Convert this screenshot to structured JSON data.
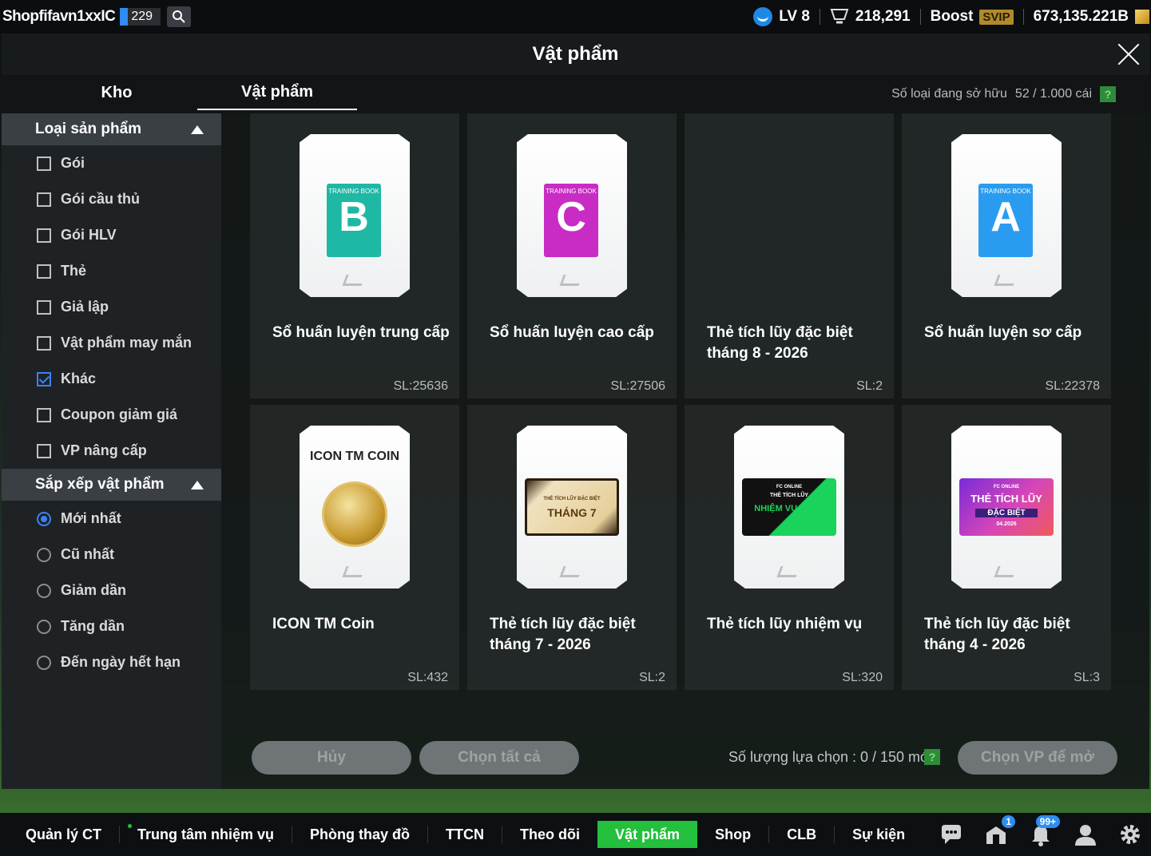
{
  "topbar": {
    "username": "Shopfifavn1xxIC",
    "count": "229",
    "level": "LV 8",
    "points": "218,291",
    "boost_label": "Boost",
    "svip_label": "SVIP",
    "balance": "673,135.221B"
  },
  "modal": {
    "title": "Vật phẩm",
    "tabs": [
      {
        "label": "Kho"
      },
      {
        "label": "Vật phẩm"
      }
    ]
  },
  "sidebar": {
    "category_header": "Loại sản phẩm",
    "categories": [
      {
        "label": "Gói",
        "checked": false
      },
      {
        "label": "Gói cầu thủ",
        "checked": false
      },
      {
        "label": "Gói HLV",
        "checked": false
      },
      {
        "label": "Thẻ",
        "checked": false
      },
      {
        "label": "Giả lập",
        "checked": false
      },
      {
        "label": "Vật phẩm may mắn",
        "checked": false
      },
      {
        "label": "Khác",
        "checked": true
      },
      {
        "label": "Coupon giảm giá",
        "checked": false
      },
      {
        "label": "VP nâng cấp",
        "checked": false
      }
    ],
    "sort_header": "Sắp xếp vật phẩm",
    "sort_options": [
      {
        "label": "Mới nhất",
        "selected": true
      },
      {
        "label": "Cũ nhất",
        "selected": false
      },
      {
        "label": "Giảm dần",
        "selected": false
      },
      {
        "label": "Tăng dần",
        "selected": false
      },
      {
        "label": "Đến ngày hết hạn",
        "selected": false
      }
    ]
  },
  "owned": {
    "label": "Số loại đang sở hữu",
    "value": "52 / 1.000 cái",
    "help": "?"
  },
  "items": [
    {
      "name": "Sổ huấn luyện trung cấp",
      "qty": "SL:25636",
      "book_label": "TRAINING BOOK",
      "book_letter": "B",
      "book_color": "#1fb8a4"
    },
    {
      "name": "Sổ huấn luyện cao cấp",
      "qty": "SL:27506",
      "book_label": "TRAINING BOOK",
      "book_letter": "C",
      "book_color": "#c82cc4"
    },
    {
      "name": "Thẻ tích lũy đặc biệt tháng 8 - 2026",
      "qty": "SL:2"
    },
    {
      "name": "Sổ huấn luyện sơ cấp",
      "qty": "SL:22378",
      "book_label": "TRAINING BOOK",
      "book_letter": "A",
      "book_color": "#2a9cf0"
    },
    {
      "name": "ICON TM Coin",
      "qty": "SL:432",
      "img_title": "ICON TM COIN"
    },
    {
      "name": "Thẻ tích lũy đặc biệt tháng 7 - 2026",
      "qty": "SL:2",
      "ticket_small": "THẺ TÍCH LŨY ĐẶC BIỆT",
      "ticket_big": "THÁNG 7"
    },
    {
      "name": "Thẻ tích lũy nhiệm vụ",
      "qty": "SL:320",
      "ticket_small": "THẺ TÍCH LŨY",
      "ticket_big": "NHIỆM VỤ TUẦN",
      "ticket_brand": "FC ONLINE"
    },
    {
      "name": "Thẻ tích lũy đặc biệt tháng 4 - 2026",
      "qty": "SL:3",
      "ticket_small": "THẺ TÍCH LŨY",
      "ticket_big": "ĐẶC BIỆT",
      "ticket_date": "04.2026",
      "ticket_brand": "FC ONLINE"
    }
  ],
  "actions": {
    "cancel": "Hủy",
    "select_all": "Chọn tất cả",
    "selection_count": "Số lượng lựa chọn : 0 / 150 món",
    "help": "?",
    "open_selected": "Chọn VP để mở"
  },
  "bottomnav": {
    "items": [
      {
        "label": "Quản lý CT"
      },
      {
        "label": "Trung tâm nhiệm vụ"
      },
      {
        "label": "Phòng thay đồ"
      },
      {
        "label": "TTCN"
      },
      {
        "label": "Theo dõi"
      },
      {
        "label": "Vật phẩm"
      },
      {
        "label": "Shop"
      },
      {
        "label": "CLB"
      },
      {
        "label": "Sự kiện"
      }
    ],
    "mail_badge": "1",
    "notif_badge": "99+",
    "accent": "#22c03c"
  }
}
